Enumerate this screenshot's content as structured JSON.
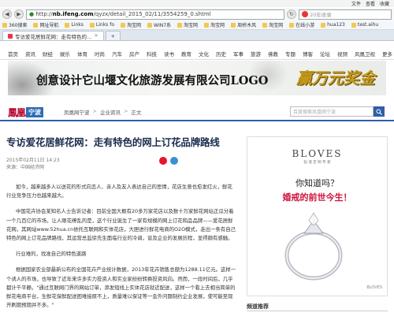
{
  "browser": {
    "menu": [
      "文件",
      "查看",
      "收藏"
    ],
    "url_host": "nb.ifeng.com",
    "url_path": "/qyzx/detail_2015_02/11/3554259_0.shtml",
    "search_text": "20年收录"
  },
  "favorites": [
    "360搜索",
    "网址导航",
    "Links",
    "Links fo",
    "淘宝网",
    "WIN7系",
    "淘宝网",
    "淘宝网",
    "周桥木风",
    "淘宝网",
    "在线小游",
    "hua123",
    "test.aihu"
  ],
  "tabs": [
    {
      "label": "专访爱花居鲜花网：走有特色的…",
      "active": true
    },
    {
      "label": "",
      "active": false
    }
  ],
  "sitenav": [
    "首页",
    "资讯",
    "财经",
    "娱乐",
    "体育",
    "时尚",
    "汽车",
    "房产",
    "科技",
    "读书",
    "教育",
    "文化",
    "历史",
    "军事",
    "旅游",
    "佛教",
    "专题",
    "博客",
    "论坛",
    "视频",
    "风凰卫视"
  ],
  "sitenav_more": "更多",
  "banner": {
    "title": "创意设计它山堰文化旅游发展有限公司LOGO",
    "calligraphy": "赢万元奖金"
  },
  "logo": {
    "main": "鳳凰",
    "city": "宁波"
  },
  "breadcrumb": [
    "凤凰网宁波",
    "企业资讯",
    "正文"
  ],
  "site_search_placeholder": "百度搜索凤凰网宁波",
  "article": {
    "title": "专访爱花居鲜花网：走有特色的网上订花品牌路线",
    "date": "2015年02月11日 14:23",
    "source": "来源：中国经济网",
    "paragraphs": [
      "如今，越来越多人以送花的形式向恋人、亲人及友人表达自己的思情，花店生意也愈发红火，鲜花行业竞争压力也越来越大。",
      "中国花卉协会某知名人士告诉记者：目前全国大概有20多万家花店以及数十万家鲜花网站正瓜分着一个几百亿的市场，让人眼花缭乱的是，这个行业诞生了一家有规模的网上订花和品品牌——爱花居鲜花网，其网站www.52hua.cn依托互联网和实体花店，大胆进行鲜花电商的O2O模式，走出一条有自己特色的网上订花品牌路线，其运营总监徐先生面临行业的冷调，谈及企业的发展历程，显得颇有感触。",
      "行业难的，找准自己的特色道路",
      "根据国家农业部最新公布的全国花卉产业统计数据，2013年花卉销售总额为1288.11亿元。这样一个诱人的市场，也导致了近年来许多实力投资人和实业家纷纷转换投资风向。然而，一段时间后，几乎都计千平静。\"通过互联网门界的网站订单，添发短线上实体花店就近配送，这样一个看上去相当简单的鲜花电商平台，生鲜花保鲜配送困难接原不上，质量难以保证等一会外问题制约企业发展，使可能至现开刷期预期并不多。\""
    ]
  },
  "ad": {
    "brand": "BLOVES",
    "brand_sub": "钻 戒 定 制 专 家",
    "line1": "你知道吗？",
    "line2": "婚戒的前世今生！",
    "small": "BLOVES"
  },
  "channel_title": "频道推荐"
}
